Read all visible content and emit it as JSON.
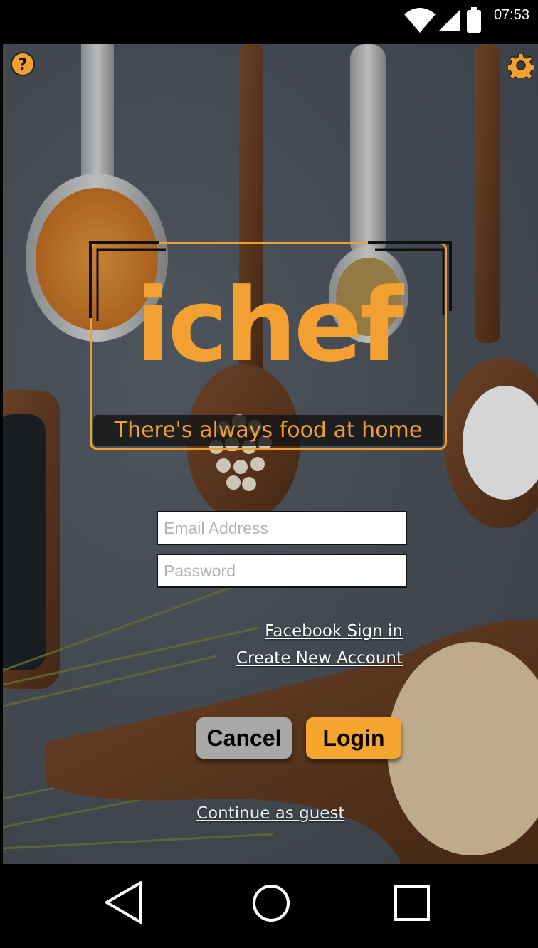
{
  "status_bar": {
    "time": "07:53",
    "icons": [
      "wifi-icon",
      "signal-icon",
      "battery-icon"
    ]
  },
  "top_icons": {
    "help": "help-icon",
    "settings": "gear-icon"
  },
  "logo": {
    "title": "ichef",
    "tagline": "There's always food at home"
  },
  "form": {
    "email_placeholder": "Email Address",
    "password_placeholder": "Password",
    "email_value": "",
    "password_value": ""
  },
  "links": {
    "facebook": "Facebook Sign in",
    "create_account": "Create New Account",
    "guest": "Continue as guest"
  },
  "buttons": {
    "cancel": "Cancel",
    "login": "Login"
  },
  "nav": {
    "icons": [
      "back-icon",
      "home-icon",
      "recents-icon"
    ]
  },
  "colors": {
    "accent": "#f2a032",
    "login_button": "#f6a531",
    "cancel_button": "#a8a8a8"
  }
}
